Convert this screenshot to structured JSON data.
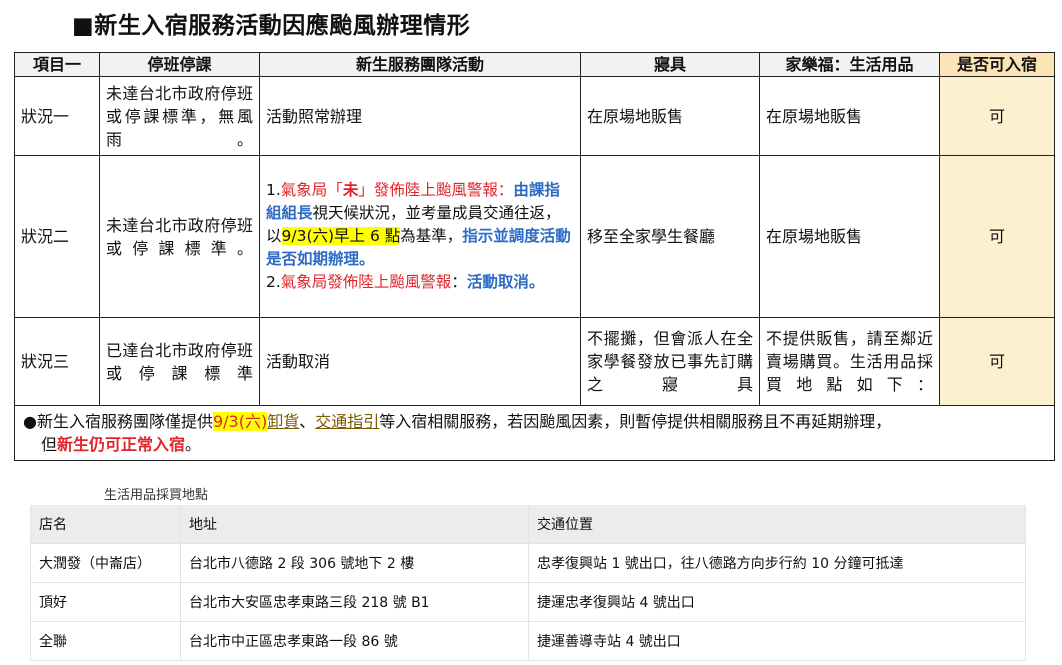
{
  "title": "■新生入宿服務活動因應颱風辦理情形",
  "table": {
    "headers": [
      "項目一",
      "停班停課",
      "新生服務團隊活動",
      "寢具",
      "家樂福：生活用品",
      "是否可入宿"
    ],
    "row1": {
      "item": "狀況一",
      "cond": "未達台北市政府停班或停課標準，無風雨。",
      "activity": "活動照常辦理",
      "bedding": "在原場地販售",
      "goods": "在原場地販售",
      "ok": "可"
    },
    "row2": {
      "item": "狀況二",
      "cond": "未達台北市政府停班或停課標準。",
      "a1_num": "1.",
      "a1_red1": "氣象局「",
      "a1_red_bold": "未",
      "a1_red2": "」發佈陸上颱風警報：",
      "a1_blue1": "由課指組組長",
      "a1_text1": "視天候狀況，並考量成員交通往返，以",
      "a1_hl": "9/3(六)早上 6 點",
      "a1_text2": "為基準，",
      "a1_blue2": "指示並調度活動是否如期辦理。",
      "a2_num": "2.",
      "a2_red": "氣象局發佈陸上颱風警報",
      "a2_colon": "：",
      "a2_blue": "活動取消。",
      "bedding": "移至全家學生餐廳",
      "goods": "在原場地販售",
      "ok": "可"
    },
    "row3": {
      "item": "狀況三",
      "cond": "已達台北市政府停班或停課標準",
      "activity": "活動取消",
      "bedding": "不擺攤，但會派人在全家學餐發放已事先訂購之寢具",
      "goods": "不提供販售，請至鄰近賣場購買。生活用品採買地點如下：",
      "ok": "可"
    },
    "note": {
      "bullet": "●",
      "t1": "新生入宿服務團隊僅提供",
      "hl": "9/3(六)",
      "u1": "卸貨",
      "t2": "、",
      "u2": "交通指引",
      "t3": "等入宿相關服務，若因颱風因素，則暫停提供相關服務且不再延期辦理，",
      "t4": "但",
      "red": "新生仍可正常入宿",
      "t5": "。"
    }
  },
  "shop_title": "生活用品採買地點",
  "shop": {
    "headers": [
      "店名",
      "地址",
      "交通位置"
    ],
    "rows": [
      [
        "大潤發（中崙店）",
        "台北市八德路 2 段 306 號地下 2 樓",
        "忠孝復興站 1 號出口，往八德路方向步行約 10 分鐘可抵達"
      ],
      [
        "頂好",
        "台北市大安區忠孝東路三段 218 號 B1",
        "捷運忠孝復興站 4 號出口"
      ],
      [
        "全聯",
        "台北市中正區忠孝東路一段 86 號",
        "捷運善導寺站 4 號出口"
      ]
    ]
  }
}
